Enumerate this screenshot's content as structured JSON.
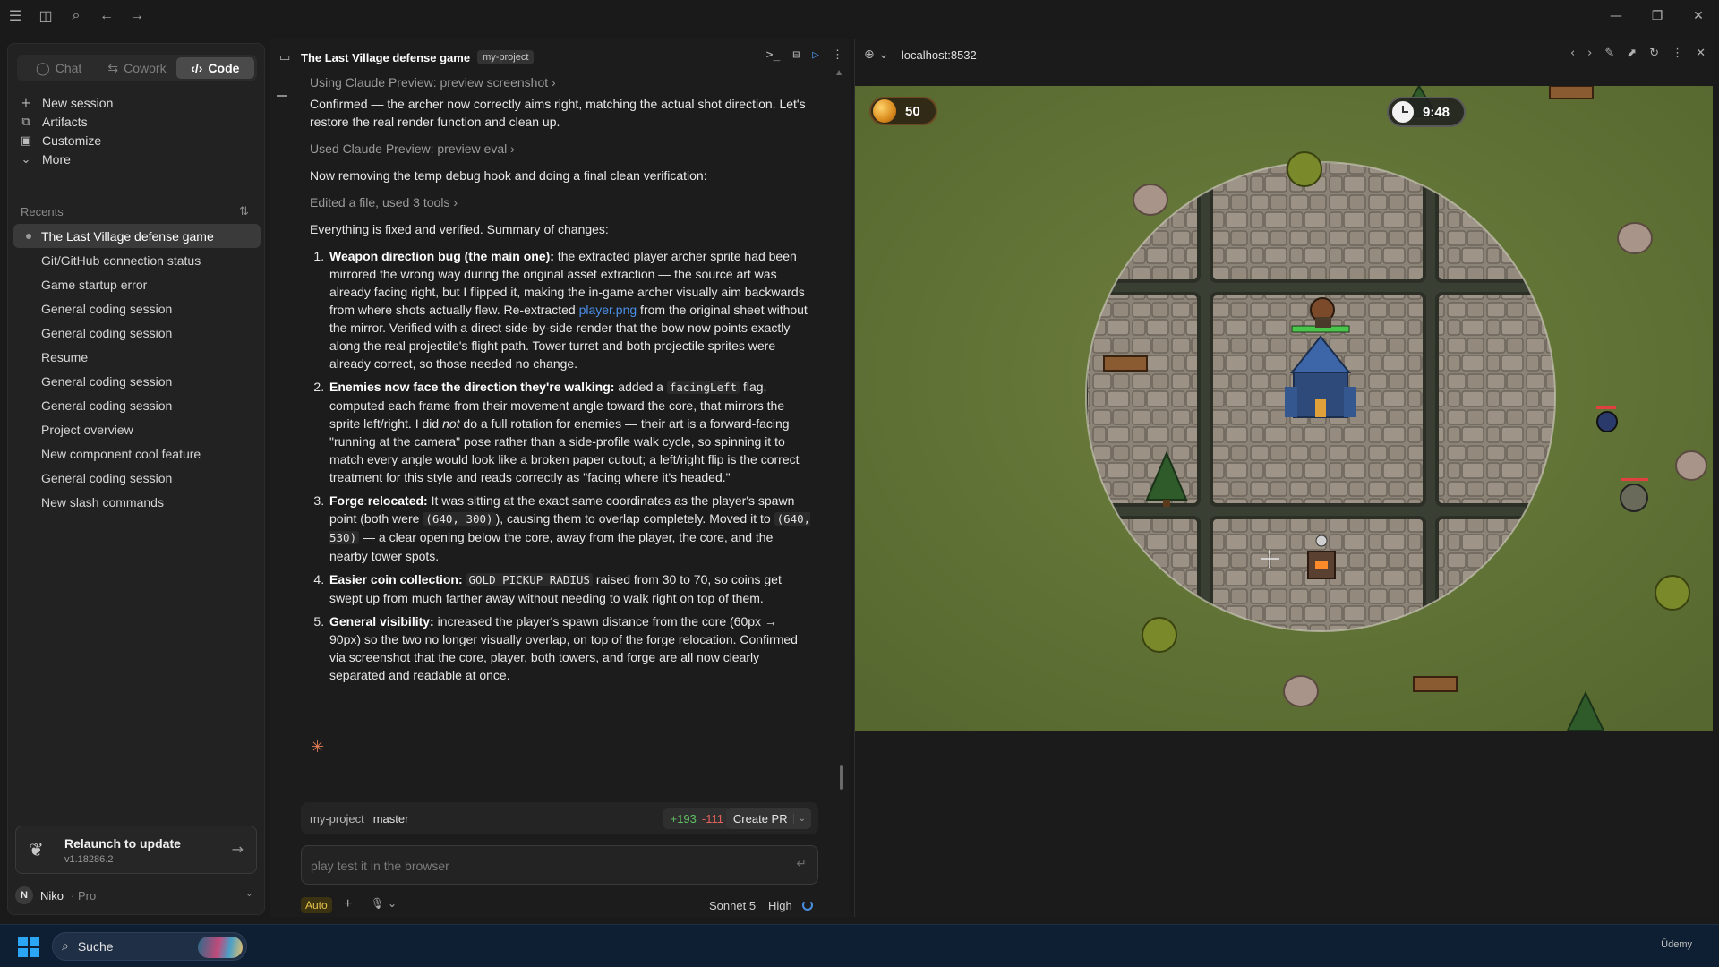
{
  "sidebar": {
    "tabs": [
      {
        "label": "Chat",
        "icon": "chat-bubble-icon"
      },
      {
        "label": "Cowork",
        "icon": "cowork-icon"
      },
      {
        "label": "Code",
        "icon": "code-icon"
      }
    ],
    "nav": [
      {
        "label": "New session",
        "icon": "+"
      },
      {
        "label": "Artifacts",
        "icon": "⧉"
      },
      {
        "label": "Customize",
        "icon": "▣"
      },
      {
        "label": "More",
        "icon": "⌄"
      }
    ],
    "recents_label": "Recents",
    "recents": [
      "The Last Village defense game",
      "Git/GitHub connection status",
      "Game startup error",
      "General coding session",
      "General coding session",
      "Resume",
      "General coding session",
      "General coding session",
      "Project overview",
      "New component cool feature",
      "General coding session",
      "New slash commands"
    ],
    "relaunch": {
      "title": "Relaunch to update",
      "version": "v1.18286.2"
    },
    "account": {
      "initial": "N",
      "name": "Niko",
      "plan": "· Pro"
    }
  },
  "chat": {
    "title": "The Last Village defense game",
    "project": "my-project",
    "tool_lines": [
      "Using Claude Preview: preview screenshot  ›",
      "Used Claude Preview: preview eval  ›",
      "Edited a file, used 3 tools  ›"
    ],
    "msg1": "Confirmed — the archer now correctly aims right, matching the actual shot direction. Let's restore the real render function and clean up.",
    "msg2": "Now removing the temp debug hook and doing a final clean verification:",
    "msg3": "Everything is fixed and verified. Summary of changes:",
    "items": {
      "i1_title": "Weapon direction bug (the main one):",
      "i1_a": " the extracted player archer sprite had been mirrored the wrong way during the original asset extraction — the source art was already facing right, but I flipped it, making the in-game archer visually aim backwards from where shots actually flew. Re-extracted ",
      "i1_link": "player.png",
      "i1_b": " from the original sheet without the mirror. Verified with a direct side-by-side render that the bow now points exactly along the real projectile's flight path. Tower turret and both projectile sprites were already correct, so those needed no change.",
      "i2_title": "Enemies now face the direction they're walking:",
      "i2_a": " added a ",
      "i2_code": "facingLeft",
      "i2_b": " flag, computed each frame from their movement angle toward the core, that mirrors the sprite left/right. I did ",
      "i2_em": "not",
      "i2_c": " do a full rotation for enemies — their art is a forward-facing \"running at the camera\" pose rather than a side-profile walk cycle, so spinning it to match every angle would look like a broken paper cutout; a left/right flip is the correct treatment for this style and reads correctly as \"facing where it's headed.\"",
      "i3_title": "Forge relocated:",
      "i3_a": " It was sitting at the exact same coordinates as the player's spawn point (both were ",
      "i3_code1": "(640, 300)",
      "i3_b": "), causing them to overlap completely. Moved it to ",
      "i3_code2": "(640, 530)",
      "i3_c": " — a clear opening below the core, away from the player, the core, and the nearby tower spots.",
      "i4_title": "Easier coin collection:",
      "i4_code": "GOLD_PICKUP_RADIUS",
      "i4_a": " raised from 30 to 70, so coins get swept up from much farther away without needing to walk right on top of them.",
      "i5_title": "General visibility:",
      "i5_a": " increased the player's spawn distance from the core (60px → 90px) so the two no longer visually overlap, on top of the forge relocation. Confirmed via screenshot that the core, player, both towers, and forge are all now clearly separated and readable at once."
    },
    "branch": {
      "project": "my-project",
      "name": "master",
      "additions": "+193",
      "deletions": "-111",
      "create_pr": "Create PR"
    },
    "input_placeholder": "play test it in the browser",
    "footer": {
      "mode": "Auto",
      "model": "Sonnet 5",
      "effort": "High"
    }
  },
  "browser": {
    "url": "localhost:8532",
    "hud": {
      "coins": "50",
      "time": "9:48"
    }
  },
  "taskbar": {
    "search": "Suche",
    "tray_app": "Ūdemy"
  },
  "colors": {
    "accent_blue": "#4a8fe0",
    "spark_orange": "#e07b53",
    "diff_add": "#5fbf63",
    "diff_del": "#e0605a"
  }
}
